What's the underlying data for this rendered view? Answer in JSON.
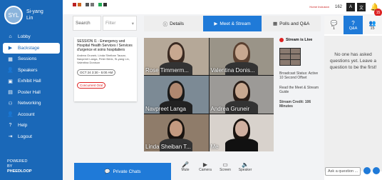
{
  "user": {
    "initials": "SYL",
    "name_line1": "Si-yang",
    "name_line2": "Lin"
  },
  "nav": [
    {
      "label": "Lobby",
      "icon": "home-icon",
      "glyph": "⌂",
      "active": false
    },
    {
      "label": "Backstage",
      "icon": "video-icon",
      "glyph": "▶",
      "active": true
    },
    {
      "label": "Sessions",
      "icon": "sessions-icon",
      "glyph": "▦",
      "active": false
    },
    {
      "label": "Speakers",
      "icon": "speakers-icon",
      "glyph": "👤",
      "active": false
    },
    {
      "label": "Exhibit Hall",
      "icon": "exhibit-icon",
      "glyph": "▣",
      "active": false
    },
    {
      "label": "Poster Hall",
      "icon": "poster-icon",
      "glyph": "▤",
      "active": false
    },
    {
      "label": "Networking",
      "icon": "networking-icon",
      "glyph": "⚇",
      "active": false
    },
    {
      "label": "Account",
      "icon": "account-icon",
      "glyph": "👤",
      "active": false
    },
    {
      "label": "Help",
      "icon": "help-icon",
      "glyph": "?",
      "active": false
    },
    {
      "label": "Logout",
      "icon": "logout-icon",
      "glyph": "⇥",
      "active": false
    }
  ],
  "powered": {
    "line1": "POWERED",
    "line2": "BY",
    "line3": "PHEEDLOOP"
  },
  "topbar": {
    "brand_logo": "Home Inclusion",
    "count": "162",
    "lang1": "A",
    "lang2": "文",
    "notif_badge": "15"
  },
  "search": {
    "label": "Search",
    "filter_placeholder": "Filter"
  },
  "session": {
    "title": "SESSION I1 - Emergency and Hospital Health Services / Services d'urgence et soins hospitaliers",
    "authors": "Andrea Gruneir, Linda Sheiban Taucar, Navpreet Langa, Peter Brink, Si-yang Lin, Valentina Donison",
    "time": "OCT 24 3:30 - 5:00 AM",
    "type": "Concurrent Oral"
  },
  "tabs": [
    {
      "label": "Details",
      "icon": "info-icon",
      "glyph": "ⓘ"
    },
    {
      "label": "Meet & Stream",
      "icon": "camera-icon",
      "glyph": "▶"
    },
    {
      "label": "Polls and Q&A",
      "icon": "poll-icon",
      "glyph": "▦"
    }
  ],
  "video": {
    "participants": [
      "Rose Timmerm...",
      "Valentina Donis...",
      "Navpreet Langa",
      "Andrea Gruneir",
      "Linda Sheiban T...",
      "Me"
    ]
  },
  "live": {
    "status": "Stream is Live",
    "broadcast_status": "Broadcast Status: Active",
    "offset": "10 Second Offset",
    "guide": "Read the Meet & Stream Guide",
    "credit": "Stream Credit: 106 Minutes"
  },
  "controls": [
    {
      "label": "Mute",
      "icon": "microphone-icon",
      "glyph": "🎤"
    },
    {
      "label": "Camera",
      "icon": "camera-icon",
      "glyph": "▶"
    },
    {
      "label": "Screen",
      "icon": "screen-icon",
      "glyph": "▭"
    },
    {
      "label": "Speaker",
      "icon": "speaker-icon",
      "glyph": "🔈"
    }
  ],
  "private_chats": "Private Chats",
  "right": {
    "tabs": [
      {
        "label": "1",
        "icon": "chat-icon",
        "glyph": "💬"
      },
      {
        "label": "Q&A",
        "icon": "question-icon",
        "glyph": "?"
      },
      {
        "label": "15",
        "icon": "people-icon",
        "glyph": "👥"
      }
    ],
    "empty_msg": "No one has asked questions yet. Leave a question to be the first!",
    "ask_placeholder": "Ask a question ..."
  }
}
